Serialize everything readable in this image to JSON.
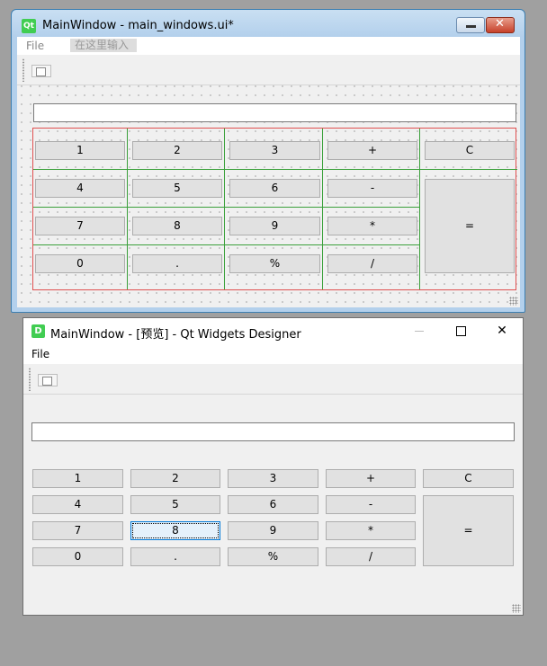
{
  "designer": {
    "title": "MainWindow - main_windows.ui*",
    "menu": {
      "file": "File",
      "type_here": "在这里输入"
    }
  },
  "preview": {
    "title": "MainWindow - [预览] - Qt Widgets Designer",
    "menu": {
      "file": "File"
    },
    "close_glyph": "✕"
  },
  "keypad": {
    "b1": "1",
    "b2": "2",
    "b3": "3",
    "plus": "+",
    "clear": "C",
    "b4": "4",
    "b5": "5",
    "b6": "6",
    "minus": "-",
    "b7": "7",
    "b8": "8",
    "b9": "9",
    "mul": "*",
    "equals": "=",
    "b0": "0",
    "dot": ".",
    "percent": "%",
    "div": "/"
  },
  "icons": {
    "app_logo": "qt-logo-icon",
    "designer_logo": "qt-designer-logo-icon",
    "toolbar_action": "window-icon"
  },
  "colors": {
    "qt_green": "#41cd52",
    "layout_red": "#e05050",
    "layout_green": "#3aa03a"
  }
}
